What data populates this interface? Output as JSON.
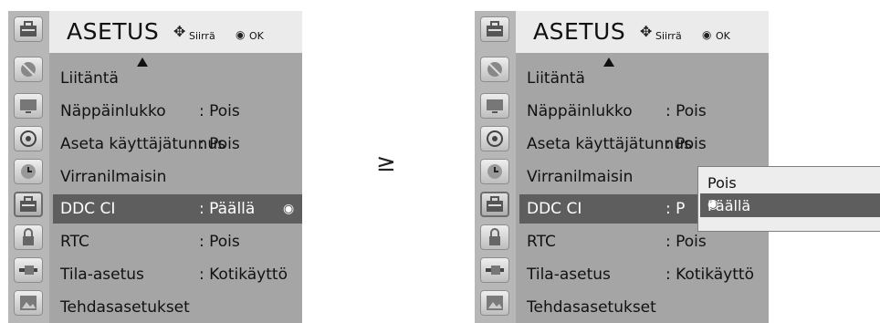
{
  "menu": {
    "title": "ASETUS",
    "hint_move": "Siirrä",
    "hint_ok": "OK",
    "items": [
      {
        "label": "Liitäntä",
        "value": ""
      },
      {
        "label": "Näppäinlukko",
        "value": ": Pois"
      },
      {
        "label": "Aseta käyttäjätunnus",
        "value": ": Pois"
      },
      {
        "label": "Virranilmaisin",
        "value": ""
      },
      {
        "label": "DDC CI",
        "value": ": Päällä"
      },
      {
        "label": "RTC",
        "value": ": Pois"
      },
      {
        "label": "Tila-asetus",
        "value": ": Kotikäyttö"
      },
      {
        "label": "Tehdasasetukset",
        "value": ""
      }
    ],
    "right_ddc_value_partial": ": P",
    "right_rtc_value": ": Pois",
    "radio_glyph": "◉"
  },
  "transition_arrow": "≥",
  "dropdown": {
    "options": [
      "Pois",
      "Päällä"
    ],
    "selected": "Päällä"
  },
  "sidebar_icons": [
    "satellite-dish-icon",
    "tv-screen-icon",
    "speaker-icon",
    "clock-icon",
    "toolbox-icon",
    "lock-icon",
    "connector-icon",
    "photo-icon"
  ],
  "colors": {
    "panel_bg": "#a5a5a5",
    "header_bg": "#ebebeb",
    "highlight_bg": "#5e5e5e"
  }
}
